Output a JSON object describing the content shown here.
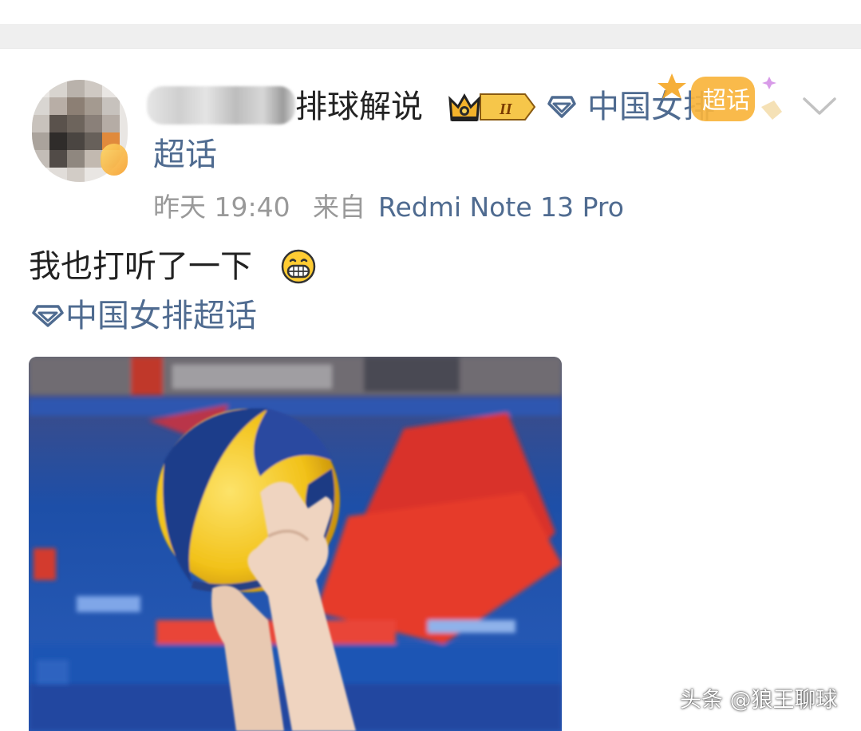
{
  "post": {
    "author_suffix": "排球解说",
    "level_badge": "II",
    "topic_line1": "中国女排",
    "topic_line2": "超话",
    "sticker_text": "超话",
    "time": "昨天 19:40",
    "source_prefix": "来自",
    "device": "Redmi Note 13 Pro",
    "text": "我也打听了一下",
    "topic_tag": "中国女排超话"
  },
  "watermark": "头条 @狼王聊球",
  "colors": {
    "link": "#4f6b90",
    "meta": "#999999",
    "text": "#222222",
    "separator": "#efefef"
  },
  "icons": [
    "crown-badge-icon",
    "diamond-topic-icon",
    "chaohua-sticker",
    "chevron-down-icon",
    "grinning-face-emoji"
  ]
}
